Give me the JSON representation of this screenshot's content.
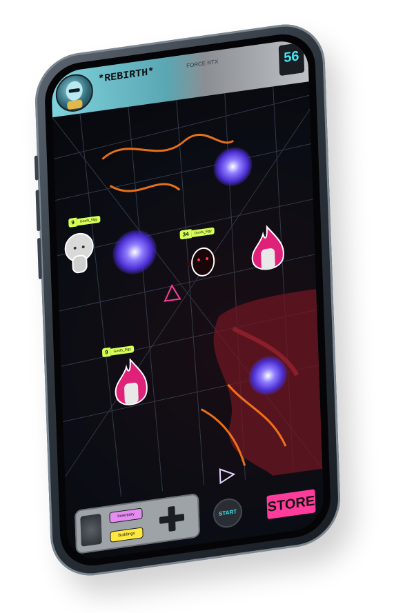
{
  "hud": {
    "title": "*REBIRTH*",
    "subtitle": "FORCE RTX",
    "level": "56",
    "level_sub": ""
  },
  "map_labels": [
    {
      "num": "9",
      "tag": "Goofs_5lgy"
    },
    {
      "num": "34",
      "tag": "Goofs_5lgy"
    },
    {
      "num": "9",
      "tag": "Goofs_5lgy"
    }
  ],
  "controls": {
    "inventory_label": "Inventory",
    "buildings_label": "Buildings",
    "start_label": "START",
    "store_label": "STORE"
  },
  "colors": {
    "accent_cyan": "#3fe7f2",
    "accent_pink": "#ff3c9b",
    "accent_lime": "#d6ff57",
    "portal_glow": "#7a5cff",
    "route_orange": "#ff7a1a",
    "map_red": "#7a1a24"
  }
}
